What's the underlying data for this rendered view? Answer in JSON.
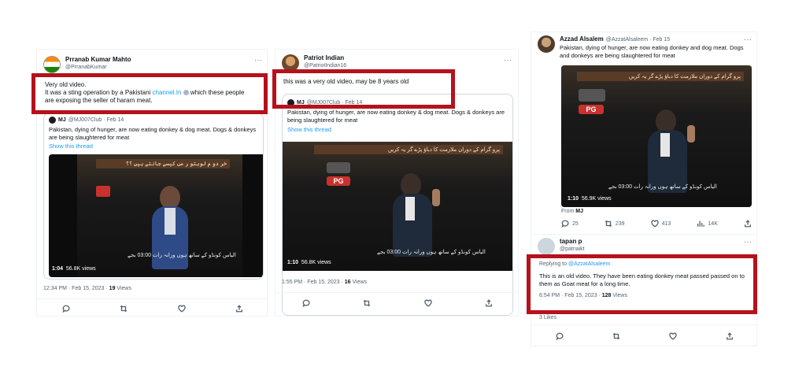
{
  "tweet1": {
    "name": "Prranab Kumar Mahto",
    "handle": "@PrranabKumar",
    "more": "···",
    "text_line1": "Very old video.",
    "text_line2_pre": "It was a sting operation by a Pakistani ",
    "text_link": "channel.In",
    "text_line2_post": " which these people",
    "text_line3": "are exposing the seller of haram meat.",
    "quote": {
      "author": "MJ",
      "meta": "@MJ007Club · Feb 14",
      "text": "Pakistan, dying of hunger, are now eating donkey & dog meat. Dogs & donkeys are being slaughtered for meat",
      "show_thread": "Show this thread",
      "video_time": "1:04",
      "video_views": "56.8K views",
      "banner": "خر دو م لوہتو ر مں کیسے جانتے ہیں ؟؟",
      "subtitle": "الیاس کونڈو کے ساتھ ہوں ورانہ رات 03:00 بجے"
    },
    "meta_time": "12:34 PM · Feb 15, 2023 · ",
    "meta_views": "19",
    "meta_views_label": " Views"
  },
  "tweet2": {
    "name": "Patriot Indian",
    "handle": "@PatriotIndian16",
    "more": "···",
    "text": "this was a very old video, may be 8 years old",
    "quote": {
      "author": "MJ",
      "meta": "@MJ007Club · Feb 14",
      "text": "Pakistan, dying of hunger, are now eating donkey & dog meat. Dogs & donkeys are being slaughtered for meat",
      "show_thread": "Show this thread",
      "video_time": "1:10",
      "video_views": "56.8K views",
      "banner": "پرو گرام کے دوران ملازمت کا دباؤ پڑے گر یہ کریں",
      "subtitle": "الیاس کونڈو کے ساتھ ہوں ورانہ رات 03:00 بجے",
      "badge": "PG"
    },
    "meta_time": "1:55 PM · Feb 15, 2023 · ",
    "meta_views": "16",
    "meta_views_label": " Views"
  },
  "tweet3": {
    "name": "Azzad Alsalem",
    "handle": "@AzzatAlsaleem · Feb 15",
    "more": "···",
    "text": "Pakistan, dying of hunger, are now eating donkey and dog meat. Dogs and donkeys are being slaughtered for meat",
    "video_time": "1:10",
    "video_views": "56.9K views",
    "banner": "پرو گرام کے دوران ملازمت کا دباؤ پڑے گر یہ کریں",
    "subtitle": "الیاس کونڈو کے ساتھ ہوں ورانہ رات 03:00 بجے",
    "badge": "PG",
    "from_label": "From ",
    "from_name": "MJ",
    "counts": {
      "replies": "25",
      "retweets": "239",
      "likes": "413",
      "views": "14K"
    }
  },
  "tweet4": {
    "name": "tapan p",
    "handle": "@patnaikt",
    "more": "···",
    "replying_label": "Replying to ",
    "replying_to": "@AzzatAlsaleem",
    "text": "This is an old video. They have been eating donkey  meat passed passed on to them as Goat meat for a long time.",
    "meta_time": "6:54 PM · Feb 15, 2023 · ",
    "meta_views": "128",
    "meta_views_label": " Views",
    "likes_label": "3 Likes"
  },
  "colors": {
    "highlight": "#b5121b",
    "link": "#1d9bf0",
    "muted": "#536471"
  },
  "icons": [
    "reply-icon",
    "retweet-icon",
    "like-icon",
    "share-icon",
    "analytics-icon"
  ]
}
